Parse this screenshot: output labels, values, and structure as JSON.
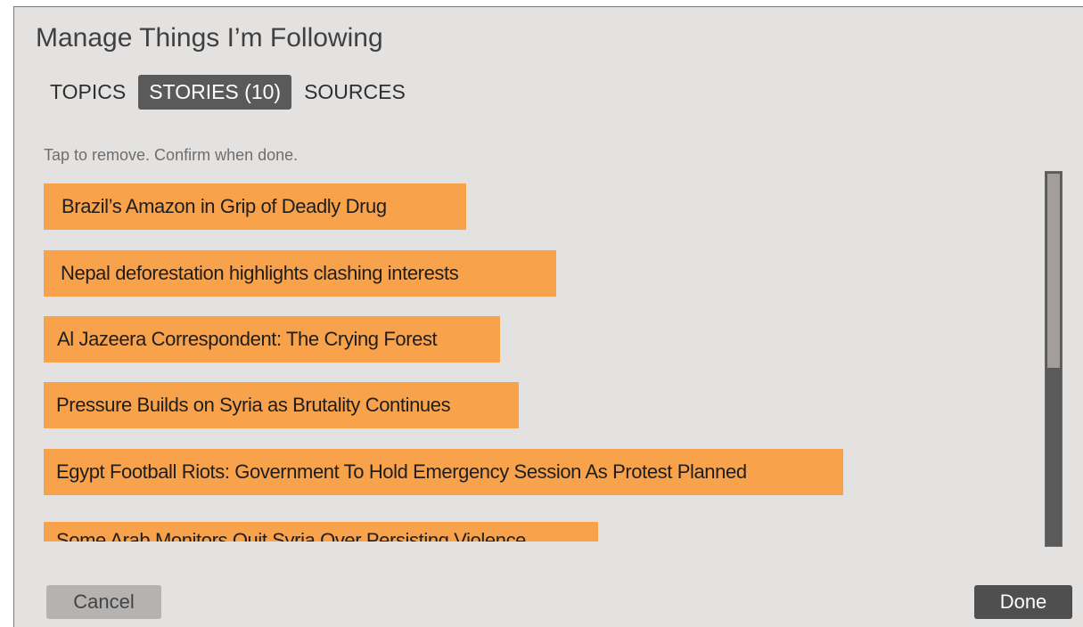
{
  "dialog": {
    "title": "Manage Things I’m Following",
    "tabs": [
      {
        "label": "TOPICS",
        "active": false
      },
      {
        "label": "STORIES (10)",
        "active": true
      },
      {
        "label": "SOURCES",
        "active": false
      }
    ],
    "instruction": "Tap to remove. Confirm when done.",
    "stories": [
      {
        "title": "Brazil’s Amazon in Grip of Deadly Drug"
      },
      {
        "title": "Nepal deforestation highlights clashing interests"
      },
      {
        "title": "Al Jazeera Correspondent: The Crying Forest"
      },
      {
        "title": "Pressure Builds on Syria as Brutality Continues"
      },
      {
        "title": "Egypt Football Riots: Government To Hold Emergency Session As Protest Planned"
      },
      {
        "title": "Some Arab Monitors Quit Syria Over Persisting Violence"
      }
    ],
    "scroll_position_fraction": 0.0,
    "cancel_label": "Cancel",
    "done_label": "Done"
  },
  "colors": {
    "story_background": "#f8a24b",
    "active_tab_background": "#5a5a5a",
    "dialog_background": "#e3e2e1"
  }
}
